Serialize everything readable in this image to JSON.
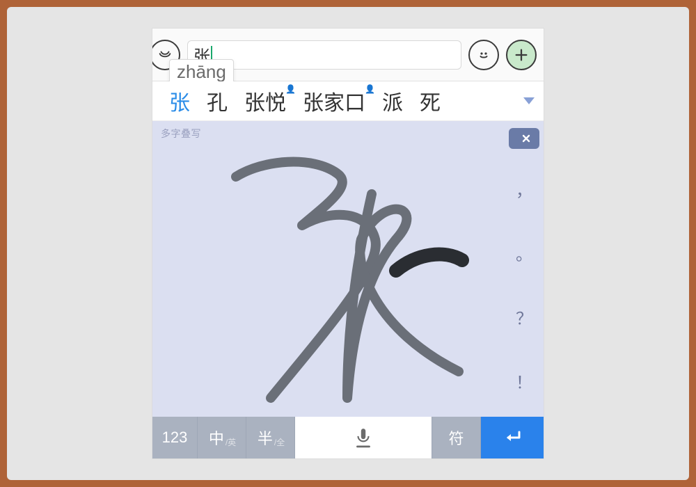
{
  "chat": {
    "input_value": "张",
    "pinyin_preview": "zhāng"
  },
  "candidates": {
    "items": [
      {
        "label": "张",
        "selected": true,
        "person": false
      },
      {
        "label": "孔",
        "selected": false,
        "person": false
      },
      {
        "label": "张悦",
        "selected": false,
        "person": true
      },
      {
        "label": "张家口",
        "selected": false,
        "person": true
      },
      {
        "label": "派",
        "selected": false,
        "person": false
      },
      {
        "label": "死",
        "selected": false,
        "person": false
      }
    ]
  },
  "handwriting": {
    "hint": "多字叠写",
    "punct": [
      "，",
      "。",
      "？",
      "！"
    ]
  },
  "keys": {
    "num": "123",
    "zh_main": "中",
    "zh_sub": "/英",
    "half_main": "半",
    "half_sub": "/全",
    "sym": "符"
  }
}
